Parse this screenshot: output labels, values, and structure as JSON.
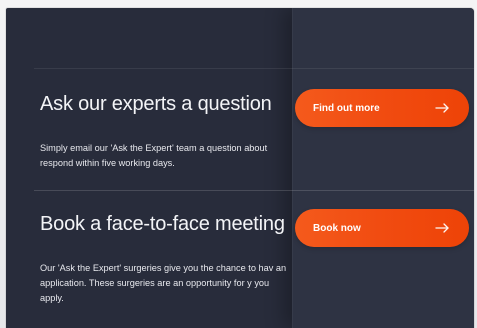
{
  "sections": [
    {
      "title": "Ask our experts a question",
      "text": "Simply email our 'Ask the Expert' team a question about respond within five working days.",
      "button_label": "Find out more",
      "button_icon": "arrow-right-icon"
    },
    {
      "title": "Book a face-to-face meeting",
      "text": "Our 'Ask the Expert' surgeries give you the chance to hav an application. These surgeries are an opportunity for y you apply.",
      "button_label": "Book now",
      "button_icon": "arrow-right-icon"
    }
  ],
  "colors": {
    "page_background": "#e9e9ea",
    "panel_background": "#282c3b",
    "right_column_background": "#2e3343",
    "title_text": "#f3f4f7",
    "body_text": "#e8e9ee",
    "accent_orange": "#f14c11"
  }
}
